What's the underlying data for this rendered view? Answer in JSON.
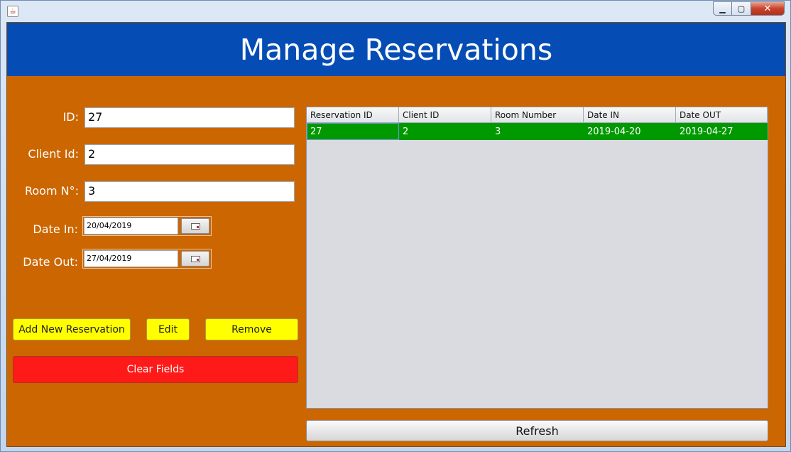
{
  "window": {
    "app_icon": "java-icon",
    "controls": {
      "minimize": "minimize-icon",
      "maximize": "maximize-icon",
      "close": "close-icon"
    }
  },
  "header": {
    "title": "Manage Reservations"
  },
  "form": {
    "id_label": "ID:",
    "id_value": "27",
    "client_label": "Client Id:",
    "client_value": "2",
    "room_label": "Room N°:",
    "room_value": "3",
    "date_in_label": "Date In:",
    "date_in_value": "20/04/2019",
    "date_out_label": "Date Out:",
    "date_out_value": "27/04/2019",
    "calendar_icon": "calendar-icon"
  },
  "buttons": {
    "add": "Add New Reservation",
    "edit": "Edit",
    "remove": "Remove",
    "clear": "Clear Fields",
    "refresh": "Refresh"
  },
  "table": {
    "columns": [
      "Reservation ID",
      "Client ID",
      "Room Number",
      "Date IN",
      "Date OUT"
    ],
    "rows": [
      [
        "27",
        "2",
        "3",
        "2019-04-20",
        "2019-04-27"
      ]
    ]
  },
  "colors": {
    "header_bg": "#054db4",
    "panel_bg": "#cc6600",
    "selected_row": "#009900",
    "action_buttons": "#ffff00",
    "clear_button": "#ff1a1a"
  }
}
